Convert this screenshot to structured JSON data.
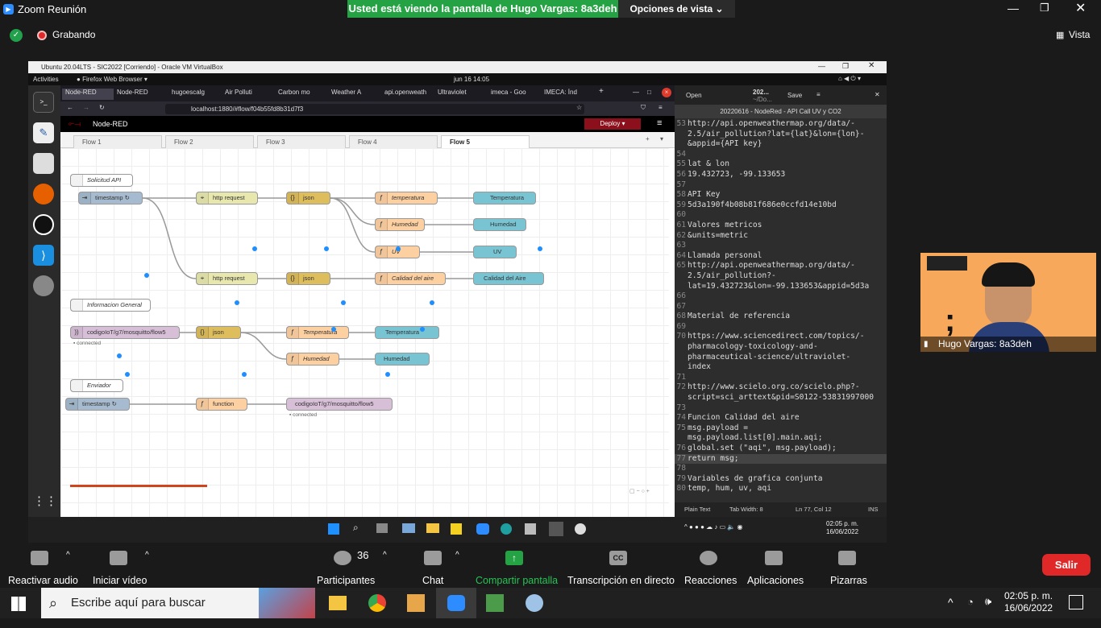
{
  "zoom": {
    "app_title": "Zoom Reunión",
    "share_banner": "Usted está viendo la pantalla de Hugo Vargas: 8a3deh",
    "view_options": "Opciones de vista",
    "recording": "Grabando",
    "view": "Vista",
    "participant_video_name": "Hugo Vargas: 8a3deh",
    "controls": {
      "audio": "Reactivar audio",
      "video": "Iniciar vídeo",
      "participants": "Participantes",
      "participants_count": "36",
      "chat": "Chat",
      "share": "Compartir pantalla",
      "transcription": "Transcripción en directo",
      "reactions": "Reacciones",
      "apps": "Aplicaciones",
      "whiteboards": "Pizarras",
      "leave": "Salir"
    }
  },
  "vm": {
    "title": "Ubuntu 20.04LTS - SIC2022 [Corriendo] - Oracle VM VirtualBox",
    "activities": "Activities",
    "browser_menu": "Firefox Web Browser",
    "datetime": "jun 16  14:05"
  },
  "firefox": {
    "tabs": [
      "Node-RED",
      "Node-RED",
      "hugoescalg",
      "Air Polluti",
      "Carbon mo",
      "Weather A",
      "api.openweath",
      "Ultraviolet",
      "imeca - Goo",
      "IMECA: Índ"
    ],
    "url": "localhost:1880/#flow/f04b55fd8b31d7f3"
  },
  "nodered": {
    "title": "Node-RED",
    "deploy": "Deploy",
    "flow_tabs": [
      "Flow 1",
      "Flow 2",
      "Flow 3",
      "Flow 4",
      "Flow 5"
    ],
    "nodes": {
      "c1": "Solicitud API",
      "inj1": "timestamp ↻",
      "http1": "http request",
      "json1": "json",
      "fn_temp": "temperatura",
      "d_temp": "Temperatura",
      "fn_hum": "Humedad",
      "d_hum": "Humedad",
      "fn_uv": "UV",
      "d_uv": "UV",
      "http2": "http request",
      "json2": "json",
      "fn_ca": "Calidad del aire",
      "d_ca": "Calidad del Aire",
      "c2": "Informacion General",
      "mqtt_in": "codigoIoT/g7/mosquitto/flow5",
      "json3": "json",
      "fn_t2": "Temperatura",
      "ch_t": "Temperatura",
      "fn_h2": "Humedad",
      "ch_h": "Humedad",
      "c3": "Enviador",
      "inj2": "timestamp ↻",
      "fn_gen": "function",
      "mqtt_out": "codigoIoT/g7/mosquitto/flow5",
      "connected": "connected"
    }
  },
  "editor": {
    "open": "Open",
    "save": "Save",
    "file_short": "202...",
    "file_path": "~/Do...",
    "tab": "20220616 - NodeRed - API Call UV y CO2",
    "lines": [
      {
        "n": "53",
        "t": "http://api.openweathermap.org/data/-"
      },
      {
        "n": "",
        "t": "2.5/air_pollution?lat={lat}&lon={lon}-"
      },
      {
        "n": "",
        "t": "&appid={API key}"
      },
      {
        "n": "54",
        "t": ""
      },
      {
        "n": "55",
        "t": "lat & lon"
      },
      {
        "n": "56",
        "t": "19.432723, -99.133653"
      },
      {
        "n": "57",
        "t": ""
      },
      {
        "n": "58",
        "t": "API Key"
      },
      {
        "n": "59",
        "t": "5d3a190f4b08b81f686e0ccfd14e10bd"
      },
      {
        "n": "60",
        "t": ""
      },
      {
        "n": "61",
        "t": "Valores metricos"
      },
      {
        "n": "62",
        "t": "&units=metric"
      },
      {
        "n": "63",
        "t": ""
      },
      {
        "n": "64",
        "t": "Llamada personal"
      },
      {
        "n": "65",
        "t": "http://api.openweathermap.org/data/-"
      },
      {
        "n": "",
        "t": "2.5/air_pollution?-"
      },
      {
        "n": "",
        "t": "lat=19.432723&lon=-99.133653&appid=5d3a"
      },
      {
        "n": "66",
        "t": ""
      },
      {
        "n": "67",
        "t": ""
      },
      {
        "n": "68",
        "t": "Material de referencia"
      },
      {
        "n": "69",
        "t": ""
      },
      {
        "n": "70",
        "t": "https://www.sciencedirect.com/topics/-"
      },
      {
        "n": "",
        "t": "pharmacology-toxicology-and-"
      },
      {
        "n": "",
        "t": "pharmaceutical-science/ultraviolet-"
      },
      {
        "n": "",
        "t": "index"
      },
      {
        "n": "71",
        "t": ""
      },
      {
        "n": "72",
        "t": "http://www.scielo.org.co/scielo.php?-"
      },
      {
        "n": "",
        "t": "script=sci_arttext&pid=S0122-53831997000"
      },
      {
        "n": "73",
        "t": ""
      },
      {
        "n": "74",
        "t": "Funcion Calidad del aire"
      },
      {
        "n": "75",
        "t": "msg.payload ="
      },
      {
        "n": "",
        "t": "msg.payload.list[0].main.aqi;"
      },
      {
        "n": "76",
        "t": "global.set (\"aqi\", msg.payload);"
      },
      {
        "n": "77",
        "t": "return msg;"
      },
      {
        "n": "78",
        "t": ""
      },
      {
        "n": "79",
        "t": "Variables de grafica conjunta"
      },
      {
        "n": "80",
        "t": "temp, hum, uv, aqi"
      }
    ],
    "status_mode": "Plain Text",
    "status_tab": "Tab Width: 8",
    "status_pos": "Ln 77, Col 12",
    "status_ins": "INS"
  },
  "vm_windows_clock": {
    "time": "02:05 p. m.",
    "date": "16/06/2022"
  },
  "windows": {
    "search_placeholder": "Escribe aquí para buscar",
    "time": "02:05 p. m.",
    "date": "16/06/2022"
  }
}
